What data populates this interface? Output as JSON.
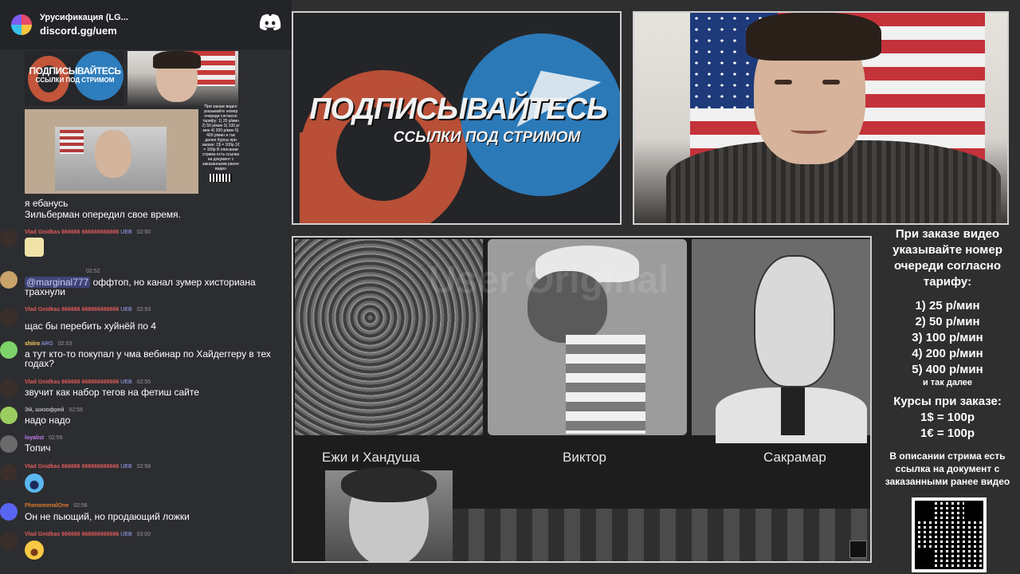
{
  "discord": {
    "server_name": "Урусификация (LG...",
    "invite": "discord.gg/uem",
    "logo_icon": "discord-logo-icon"
  },
  "chat_thumbnails": {
    "promo_title": "ПОДПИСЫВАЙТЕСЬ",
    "promo_subtitle": "ССЫЛКИ ПОД СТРИМОМ",
    "price_card": "При заказе видео указывайте номер очереди согласно тарифу: 1) 25 р/мин 2) 50 р/мин 3) 100 р/мин 4) 200 р/мин 5) 400 р/мин и так далее Курсы при заказе: 1$ = 100р 1€ = 100р В описании стрима есть ссылка на документ с заказанными ранее видео"
  },
  "pinned": {
    "line1": "я ебанусь",
    "line2": "Зильберман опередил свое время."
  },
  "messages": [
    {
      "user": "Vlad Gnidkas 666666 666666666666",
      "badge": "UEB",
      "time": "02:50",
      "text": "",
      "emoji": "cup-emoji",
      "color": "#e05a5a"
    },
    {
      "user": "",
      "badge": "",
      "time": "02:52",
      "mention": "@marginal777",
      "text": " оффтоп, но канал зумер хисториана трахнули",
      "color": "#c9a36a"
    },
    {
      "user": "Vlad Gnidkas 666666 666666666666",
      "badge": "UEB",
      "time": "02:53",
      "text": "щас бы перебить хуйнёй по 4",
      "color": "#e05a5a"
    },
    {
      "user": "shiiro",
      "badge": "ARG",
      "time": "02:53",
      "text": "а тут кто-то покупал у чма вебинар по Хайдеггеру в тех годах?",
      "color": "#ffd15a"
    },
    {
      "user": "Vlad Gnidkas 666666 666666666666",
      "badge": "UEB",
      "time": "02:55",
      "text": "звучит как набор тегов на фетиш сайте",
      "color": "#e05a5a"
    },
    {
      "user": "Эй, шизофрей",
      "badge": "",
      "time": "02:56",
      "text": "надо надо",
      "color": "#b5b5b5"
    },
    {
      "user": "loyalist",
      "badge": "",
      "time": "02:56",
      "text": "Топич",
      "color": "#c27cf0"
    },
    {
      "user": "Vlad Gnidkas 666666 666666666666",
      "badge": "UEB",
      "time": "02:58",
      "text": "",
      "emoji": "shocked-emoji",
      "color": "#e05a5a"
    },
    {
      "user": "PhenomenalOne",
      "badge": "",
      "time": "02:58",
      "text": "Он не пьющий, но продающий ложки",
      "color": "#e0782f"
    },
    {
      "user": "Vlad Gnidkas 666666 666666666666",
      "badge": "UEB",
      "time": "03:00",
      "text": "",
      "emoji": "crying-laughing-emoji",
      "color": "#e05a5a"
    }
  ],
  "promo": {
    "title": "ПОДПИСЫВАЙТЕСЬ",
    "subtitle": "ССЫЛКИ ПОД СТРИМОМ"
  },
  "meme": {
    "labels": [
      "Ежи и Хандуша",
      "Виктор",
      "Сакрамар"
    ],
    "watermark": "User Original"
  },
  "info": {
    "intro": "При заказе видео указывайте номер очереди согласно тарифу:",
    "rates": [
      "1) 25 р/мин",
      "2) 50 р/мин",
      "3) 100 р/мин",
      "4) 200 р/мин",
      "5) 400 р/мин"
    ],
    "rates_more": "и так далее",
    "courses_head": "Курсы при заказе:",
    "courses": [
      "1$ = 100р",
      "1€ = 100р"
    ],
    "desc_note": "В описании стрима есть ссылка на документ с заказанными ранее видео"
  }
}
